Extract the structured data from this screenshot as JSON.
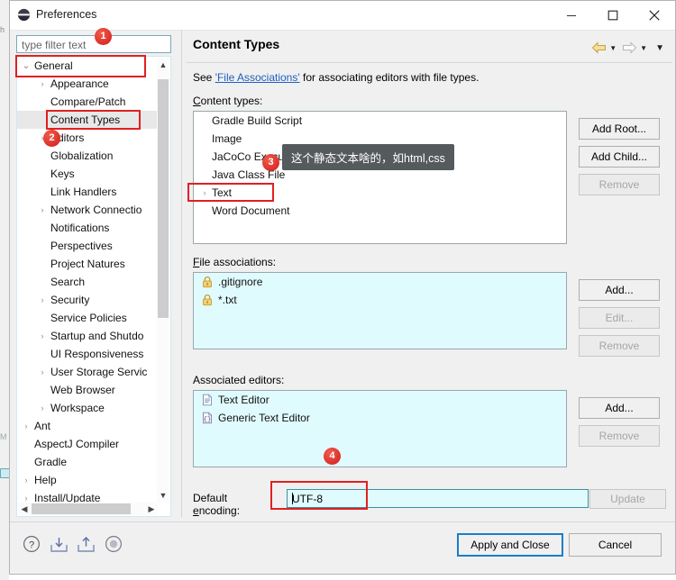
{
  "window": {
    "title": "Preferences",
    "icon": "eclipse-icon",
    "minimize_label": "Minimize",
    "maximize_label": "Maximize",
    "close_label": "Close"
  },
  "filter": {
    "placeholder": "type filter text",
    "value": ""
  },
  "tree": {
    "items": [
      {
        "label": "General",
        "level": 0,
        "arrow": "expanded",
        "selected": false
      },
      {
        "label": "Appearance",
        "level": 1,
        "arrow": "collapsed",
        "selected": false
      },
      {
        "label": "Compare/Patch",
        "level": 1,
        "arrow": "none",
        "selected": false
      },
      {
        "label": "Content Types",
        "level": 1,
        "arrow": "none",
        "selected": true
      },
      {
        "label": "Editors",
        "level": 1,
        "arrow": "collapsed",
        "selected": false
      },
      {
        "label": "Globalization",
        "level": 1,
        "arrow": "none",
        "selected": false
      },
      {
        "label": "Keys",
        "level": 1,
        "arrow": "none",
        "selected": false
      },
      {
        "label": "Link Handlers",
        "level": 1,
        "arrow": "none",
        "selected": false
      },
      {
        "label": "Network Connectio",
        "level": 1,
        "arrow": "collapsed",
        "selected": false
      },
      {
        "label": "Notifications",
        "level": 1,
        "arrow": "none",
        "selected": false
      },
      {
        "label": "Perspectives",
        "level": 1,
        "arrow": "none",
        "selected": false
      },
      {
        "label": "Project Natures",
        "level": 1,
        "arrow": "none",
        "selected": false
      },
      {
        "label": "Search",
        "level": 1,
        "arrow": "none",
        "selected": false
      },
      {
        "label": "Security",
        "level": 1,
        "arrow": "collapsed",
        "selected": false
      },
      {
        "label": "Service Policies",
        "level": 1,
        "arrow": "none",
        "selected": false
      },
      {
        "label": "Startup and Shutdo",
        "level": 1,
        "arrow": "collapsed",
        "selected": false
      },
      {
        "label": "UI Responsiveness",
        "level": 1,
        "arrow": "none",
        "selected": false
      },
      {
        "label": "User Storage Servic",
        "level": 1,
        "arrow": "collapsed",
        "selected": false
      },
      {
        "label": "Web Browser",
        "level": 1,
        "arrow": "none",
        "selected": false
      },
      {
        "label": "Workspace",
        "level": 1,
        "arrow": "collapsed",
        "selected": false
      },
      {
        "label": "Ant",
        "level": 0,
        "arrow": "collapsed",
        "selected": false
      },
      {
        "label": "AspectJ Compiler",
        "level": 0,
        "arrow": "none",
        "selected": false
      },
      {
        "label": "Gradle",
        "level": 0,
        "arrow": "none",
        "selected": false
      },
      {
        "label": "Help",
        "level": 0,
        "arrow": "collapsed",
        "selected": false
      },
      {
        "label": "Install/Update",
        "level": 0,
        "arrow": "collapsed",
        "selected": false
      }
    ]
  },
  "pane": {
    "title": "Content Types",
    "nav": {
      "back_icon": "back-arrow-icon",
      "back_menu_icon": "chevron-down-icon",
      "forward_icon": "forward-arrow-icon",
      "forward_menu_icon": "chevron-down-icon",
      "view_menu_icon": "chevron-down-icon"
    },
    "intro": {
      "prefix": "See ",
      "link": "'File Associations'",
      "suffix": " for associating editors with file types."
    },
    "content_types": {
      "label": "Content types:",
      "items": [
        {
          "label": "Gradle Build Script",
          "arrow": "none"
        },
        {
          "label": "Image",
          "arrow": "none"
        },
        {
          "label": "JaCoCo Execution Data File",
          "arrow": "none"
        },
        {
          "label": "Java Class File",
          "arrow": "none"
        },
        {
          "label": "Text",
          "arrow": "collapsed"
        },
        {
          "label": "Word Document",
          "arrow": "none"
        }
      ],
      "buttons": [
        {
          "label": "Add Root...",
          "enabled": true
        },
        {
          "label": "Add Child...",
          "enabled": true
        },
        {
          "label": "Remove",
          "enabled": false
        }
      ]
    },
    "file_associations": {
      "label": "File associations:",
      "items": [
        {
          "label": ".gitignore",
          "icon": "lock-icon"
        },
        {
          "label": "*.txt",
          "icon": "lock-icon"
        }
      ],
      "buttons": [
        {
          "label": "Add...",
          "enabled": true
        },
        {
          "label": "Edit...",
          "enabled": false
        },
        {
          "label": "Remove",
          "enabled": false
        }
      ]
    },
    "associated_editors": {
      "label": "Associated editors:",
      "items": [
        {
          "label": "Text Editor",
          "icon": "text-editor-icon"
        },
        {
          "label": "Generic Text Editor",
          "icon": "generic-text-editor-icon"
        }
      ],
      "buttons": [
        {
          "label": "Add...",
          "enabled": true
        },
        {
          "label": "Remove",
          "enabled": false
        }
      ]
    },
    "default_encoding": {
      "label": "Default encoding:",
      "value": "UTF-8",
      "update_button": {
        "label": "Update",
        "enabled": false
      }
    }
  },
  "bottom": {
    "icons": [
      {
        "name": "help-icon",
        "title": "Help"
      },
      {
        "name": "import-icon",
        "title": "Import"
      },
      {
        "name": "export-icon",
        "title": "Export"
      },
      {
        "name": "restore-defaults-icon",
        "title": "Restore Defaults"
      }
    ],
    "apply_and_close": "Apply and Close",
    "cancel": "Cancel"
  },
  "annotations": {
    "badges": [
      {
        "n": "1"
      },
      {
        "n": "2"
      },
      {
        "n": "3"
      },
      {
        "n": "4"
      }
    ],
    "tooltip": "这个静态文本啥的，如html,css"
  },
  "background": {
    "left_char": "h",
    "left_char2": "M"
  },
  "colors": {
    "accent_red": "#e02020",
    "link_blue": "#1f5fbf",
    "field_cyan": "#e0fbfd",
    "default_button_border": "#1a7ec8",
    "tooltip_bg": "#555a5c"
  }
}
